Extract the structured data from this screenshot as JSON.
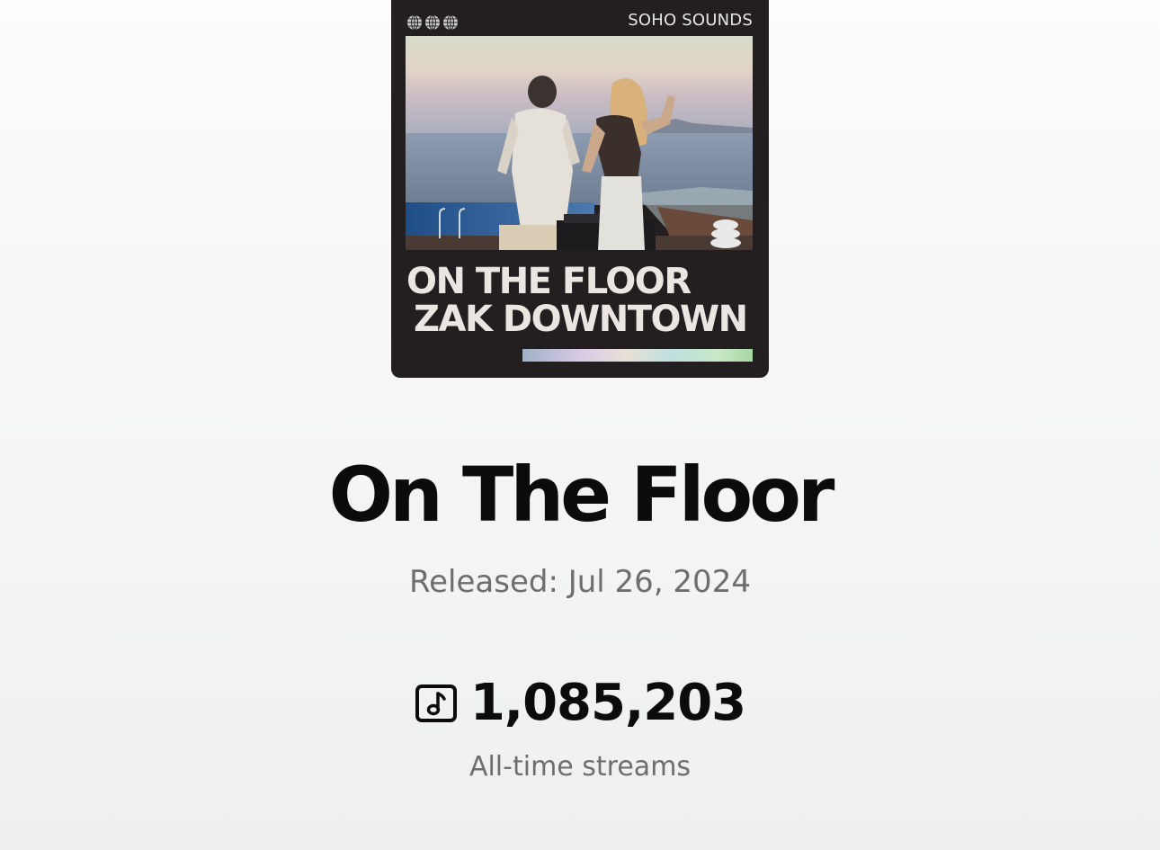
{
  "cover": {
    "label": "SOHO SOUNDS",
    "title": "ON THE FLOOR",
    "artist": "ZAK DOWNTOWN",
    "icon": "globe-icon"
  },
  "track": {
    "title": "On The Floor",
    "released_label": "Released:",
    "released_date": "Jul 26, 2024"
  },
  "streams": {
    "icon": "music-note-icon",
    "count": "1,085,203",
    "label": "All-time streams"
  }
}
